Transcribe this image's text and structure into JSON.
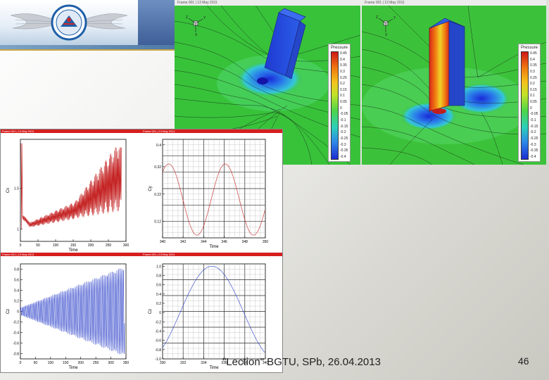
{
  "footer": {
    "text": "\"Lection\" BGTU, SPb, 26.04.2013",
    "page_number": "46"
  },
  "logo": {
    "name": "aviation emblem",
    "colors": [
      "#1f5fa8",
      "#d8d8d8",
      "#c92828"
    ]
  },
  "cfd_left": {
    "header": "Frame 001 | 13 May 2011",
    "legend": {
      "title": "Pressure",
      "labels": [
        "0.45",
        "0.4",
        "0.35",
        "0.3",
        "0.25",
        "0.2",
        "0.15",
        "0.1",
        "0.05",
        "0",
        "-0.05",
        "-0.1",
        "-0.15",
        "-0.2",
        "-0.25",
        "-0.3",
        "-0.35",
        "-0.4"
      ]
    }
  },
  "cfd_right": {
    "header": "Frame 001 | 13 May 2011",
    "legend": {
      "title": "Pressure",
      "labels": [
        "0.45",
        "0.4",
        "0.35",
        "0.3",
        "0.25",
        "0.2",
        "0.15",
        "0.1",
        "0.05",
        "0",
        "-0.05",
        "-0.1",
        "-0.15",
        "-0.2",
        "-0.25",
        "-0.3",
        "-0.35",
        "-0.4"
      ]
    }
  },
  "plot_titles": [
    "Frame 001 | 13 May 2011",
    "Frame 001 | 13 May 2011",
    "Frame 001 | 13 May 2011",
    "Frame 001 | 13 May 2011"
  ],
  "chart_data": [
    {
      "type": "line",
      "xlabel": "Time",
      "ylabel": "Cx",
      "xticks": [
        "0",
        "50",
        "100",
        "150",
        "200",
        "250",
        "300"
      ],
      "yticks": [
        "1",
        "1.5"
      ],
      "xlim": [
        0,
        350
      ],
      "ylim": [
        0.85,
        2.1
      ],
      "color": "#c42020",
      "series_name": "",
      "description": ""
    },
    {
      "type": "line",
      "xlabel": "Time",
      "ylabel": "Cy",
      "xticks": [
        "340",
        "342",
        "344",
        "346",
        "348",
        "350"
      ],
      "yticks": [
        "0.12",
        "0.22",
        "0.32",
        "0.4"
      ],
      "xlim": [
        340,
        350
      ],
      "ylim": [
        0.06,
        0.42
      ],
      "color": "#c42020"
    },
    {
      "type": "line",
      "xlabel": "Time",
      "ylabel": "Cz",
      "xticks": [
        "0",
        "50",
        "100",
        "150",
        "200",
        "250",
        "300",
        "350"
      ],
      "yticks": [
        "0.8",
        "0.6",
        "0.4",
        "0.2",
        "0",
        "-0.2",
        "-0.4",
        "-0.6",
        "-0.8"
      ],
      "xlim": [
        0,
        360
      ],
      "ylim": [
        -0.9,
        0.9
      ],
      "color": "#2a3fc9"
    },
    {
      "type": "line",
      "xlabel": "Time",
      "ylabel": "Cz",
      "xticks": [
        "330",
        "332",
        "334",
        "336",
        "338",
        "340"
      ],
      "yticks": [
        "1.0",
        "0.8",
        "0.6",
        "0.4",
        "0.2",
        "0",
        "-0.2",
        "-0.4",
        "-0.6",
        "-0.8",
        "-1.0"
      ],
      "xlim": [
        330,
        340
      ],
      "ylim": [
        -1.0,
        1.05
      ],
      "color": "#2a3fc9"
    }
  ]
}
